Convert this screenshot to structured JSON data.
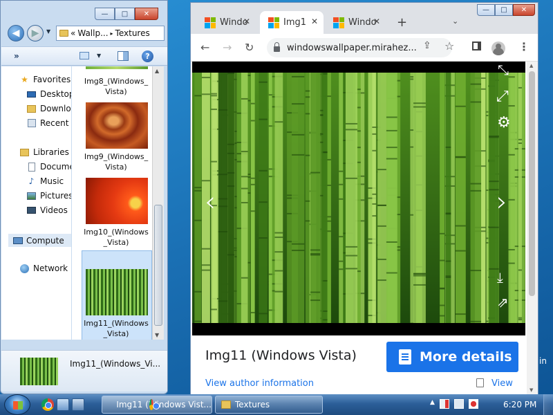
{
  "desktop": {
    "edge_text": "in"
  },
  "explorer": {
    "window_controls": {
      "minimize": "—",
      "maximize": "□",
      "close": "✕"
    },
    "address": {
      "chevron": "«",
      "crumb1": "Wallp...",
      "sep": "▸",
      "crumb2": "Textures"
    },
    "toolbar": {
      "more": "»",
      "help": "?"
    },
    "nav": {
      "favorites": "Favorites",
      "desktop": "Desktop",
      "downloads": "Downlo",
      "recent": "Recent P",
      "libraries": "Libraries",
      "documents": "Docume",
      "music": "Music",
      "pictures": "Pictures",
      "videos": "Videos",
      "computer": "Compute",
      "network": "Network"
    },
    "files": [
      {
        "label": "Img8_(Windows_\nVista)"
      },
      {
        "label": "Img9_(Windows_\nVista)"
      },
      {
        "label": "Img10_(Windows\n_Vista)"
      },
      {
        "label": "Img11_(Windows\n_Vista)"
      }
    ],
    "details": {
      "name": "Img11_(Windows_Vi..."
    }
  },
  "chrome": {
    "window_controls": {
      "minimize": "—",
      "maximize": "□",
      "close": "✕"
    },
    "tabs": [
      {
        "label": "Windo",
        "active": false
      },
      {
        "label": "Img1",
        "active": true
      },
      {
        "label": "Windo",
        "active": false
      }
    ],
    "new_tab": "+",
    "tab_menu": "⌄",
    "url": "windowswallpaper.mirahez...",
    "page": {
      "title": "Img11 (Windows Vista)",
      "more_details": "More details",
      "author_link": "View author information",
      "view_link": "View"
    }
  },
  "taskbar": {
    "items": [
      {
        "label": "Img11 (Windows Vist..."
      },
      {
        "label": "Textures"
      }
    ],
    "clock": "6:20 PM"
  }
}
